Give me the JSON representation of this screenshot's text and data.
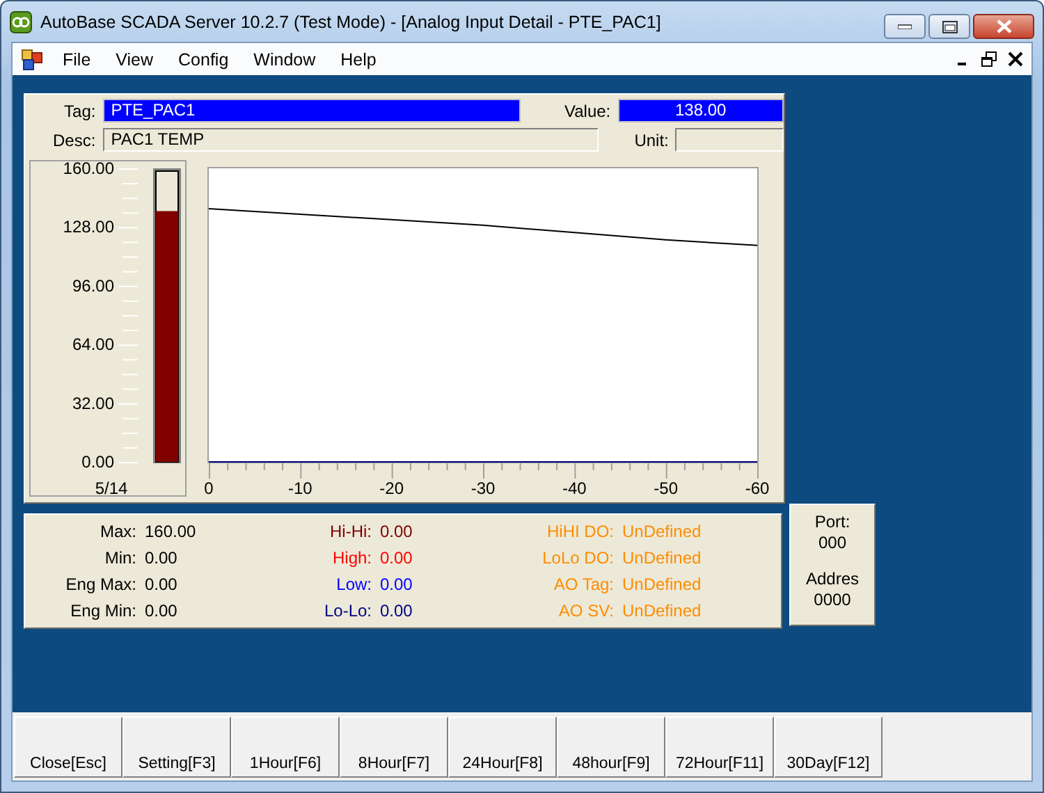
{
  "window": {
    "title": "AutoBase SCADA Server 10.2.7 (Test Mode) - [Analog Input Detail - PTE_PAC1]"
  },
  "menu": [
    "File",
    "View",
    "Config",
    "Window",
    "Help"
  ],
  "header": {
    "tag_label": "Tag:",
    "tag": "PTE_PAC1",
    "value_label": "Value:",
    "value": "138.00",
    "desc_label": "Desc:",
    "desc": "PAC1 TEMP",
    "unit_label": "Unit:"
  },
  "gauge": {
    "level": 0.8625
  },
  "trend": {
    "date": "5/14",
    "chart_data": {
      "type": "line",
      "x": [
        0,
        -10,
        -20,
        -30,
        -40,
        -50,
        -60
      ],
      "series": [
        {
          "color": "#000000",
          "values": [
            138,
            135,
            132,
            129,
            125,
            121,
            118
          ]
        }
      ],
      "xlim": [
        0,
        -60
      ],
      "ylim": [
        0,
        160
      ],
      "xticks": [
        0,
        -10,
        -20,
        -30,
        -40,
        -50,
        -60
      ],
      "yticks": [
        {
          "value": 0,
          "label": "0.00"
        },
        {
          "value": 32,
          "label": "32.00"
        },
        {
          "value": 64,
          "label": "64.00"
        },
        {
          "value": 96,
          "label": "96.00"
        },
        {
          "value": 128,
          "label": "128.00"
        },
        {
          "value": 160,
          "label": "160.00"
        }
      ]
    }
  },
  "limits": [
    {
      "label": "Max:",
      "value": "160.00",
      "color": "#000000"
    },
    {
      "label": "Hi-Hi:",
      "value": "0.00",
      "color": "#800000"
    },
    {
      "label": "HiHI DO:",
      "value": "UnDefined",
      "color": "#ff8c00"
    },
    {
      "label": "Min:",
      "value": "0.00",
      "color": "#000000"
    },
    {
      "label": "High:",
      "value": "0.00",
      "color": "#ff0000"
    },
    {
      "label": "LoLo DO:",
      "value": "UnDefined",
      "color": "#ff8c00"
    },
    {
      "label": "Eng Max:",
      "value": "0.00",
      "color": "#000000"
    },
    {
      "label": "Low:",
      "value": "0.00",
      "color": "#0000ff"
    },
    {
      "label": "AO Tag:",
      "value": "UnDefined",
      "color": "#ff8c00"
    },
    {
      "label": "Eng Min:",
      "value": "0.00",
      "color": "#000000"
    },
    {
      "label": "Lo-Lo:",
      "value": "0.00",
      "color": "#000080"
    },
    {
      "label": "AO SV:",
      "value": "UnDefined",
      "color": "#ff8c00"
    }
  ],
  "station": {
    "port_label": "Port:",
    "port": "000",
    "address_label": "Addres",
    "address": "0000"
  },
  "buttons": [
    "Close[Esc]",
    "Setting[F3]",
    "1Hour[F6]",
    "8Hour[F7]",
    "24Hour[F8]",
    "48hour[F9]",
    "72Hour[F11]",
    "30Day[F12]"
  ]
}
